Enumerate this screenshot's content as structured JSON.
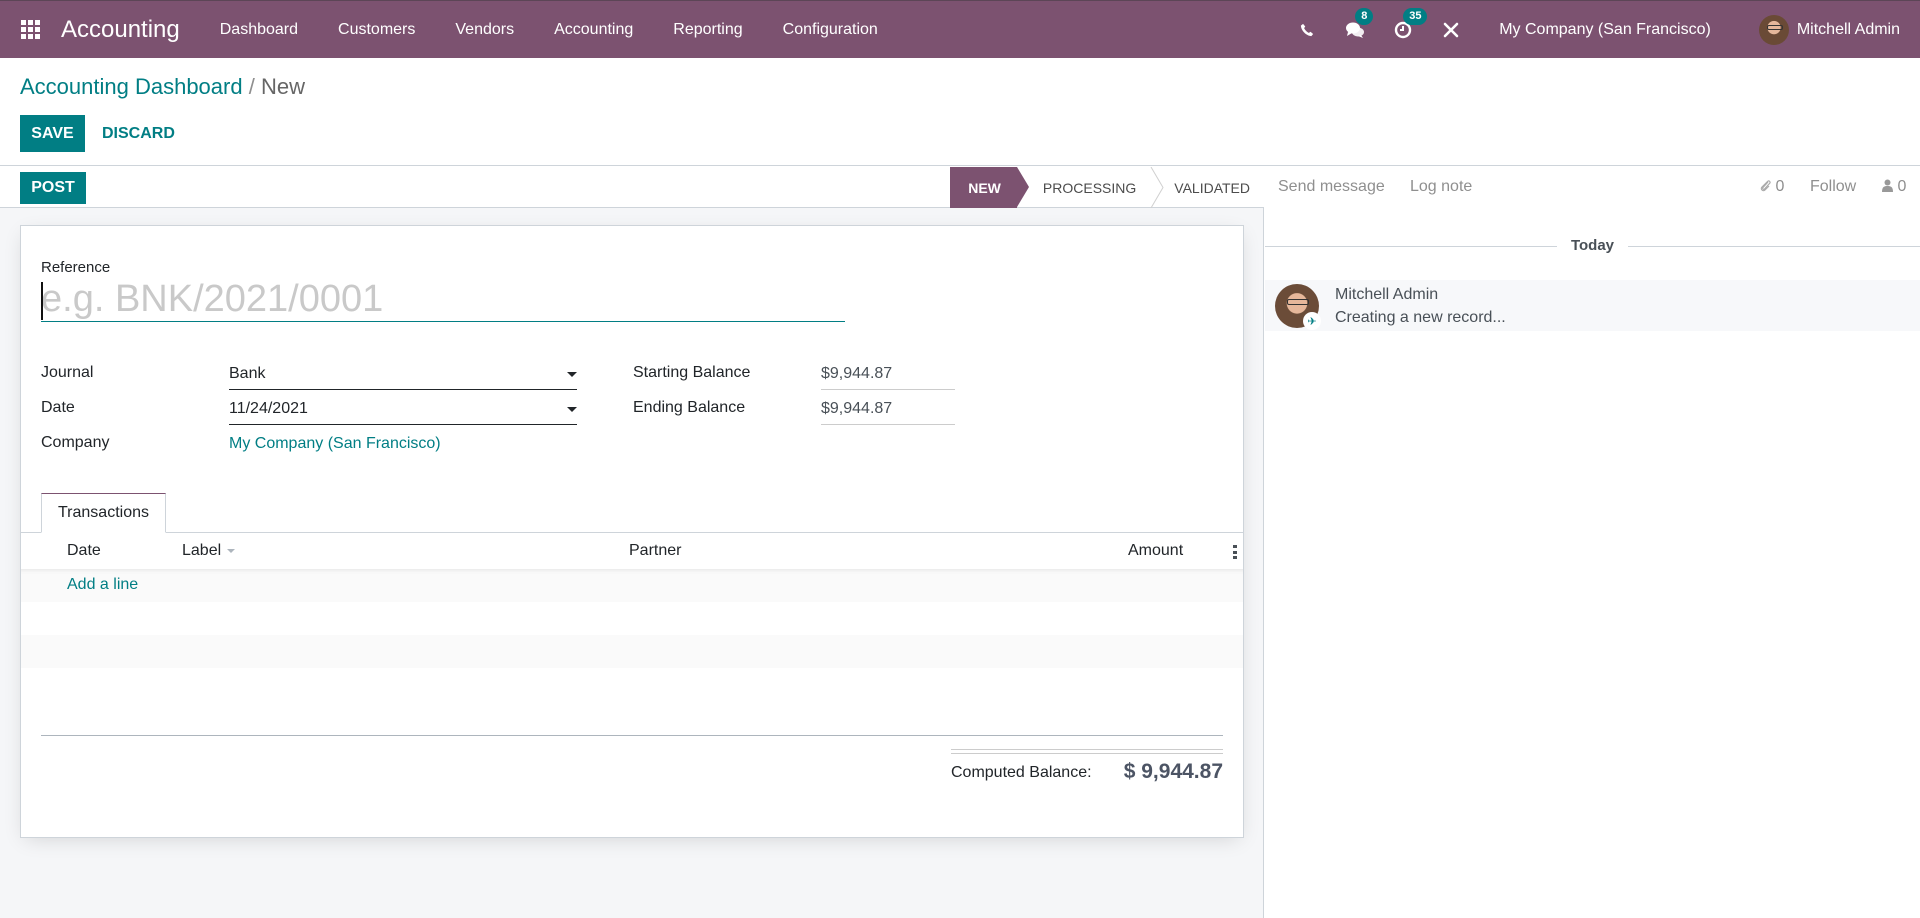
{
  "navbar": {
    "app_name": "Accounting",
    "menu": [
      "Dashboard",
      "Customers",
      "Vendors",
      "Accounting",
      "Reporting",
      "Configuration"
    ],
    "icons": {
      "apps": "apps-grid-icon",
      "phone": "phone-icon",
      "messages": "chat-icon",
      "activities": "clock-icon",
      "debug": "tools-icon"
    },
    "messages_badge": "8",
    "activities_badge": "35",
    "company": "My Company (San Francisco)",
    "user": "Mitchell Admin",
    "bg_color": "#7c5270"
  },
  "control_panel": {
    "breadcrumb_parent": "Accounting Dashboard",
    "breadcrumb_sep": "/",
    "breadcrumb_current": "New",
    "save_label": "SAVE",
    "discard_label": "DISCARD"
  },
  "statusbar": {
    "post_label": "POST",
    "stages": [
      "NEW",
      "PROCESSING",
      "VALIDATED"
    ],
    "active_stage": "NEW"
  },
  "form": {
    "reference_label": "Reference",
    "reference_value": "",
    "reference_placeholder": "e.g. BNK/2021/0001",
    "journal_label": "Journal",
    "journal_value": "Bank",
    "date_label": "Date",
    "date_value": "11/24/2021",
    "company_label": "Company",
    "company_value": "My Company (San Francisco)",
    "starting_balance_label": "Starting Balance",
    "starting_balance_value": "$9,944.87",
    "ending_balance_label": "Ending Balance",
    "ending_balance_value": "$9,944.87"
  },
  "tabs": [
    {
      "label": "Transactions",
      "active": true
    }
  ],
  "transactions": {
    "columns": [
      "Date",
      "Label",
      "Partner",
      "Amount"
    ],
    "add_line_label": "Add a line",
    "rows": [],
    "computed_balance_label": "Computed Balance:",
    "computed_balance_value": "$ 9,944.87"
  },
  "chatter": {
    "send_message_label": "Send message",
    "log_note_label": "Log note",
    "attachments_count": "0",
    "follow_label": "Follow",
    "followers_count": "0",
    "date_separator": "Today",
    "messages": [
      {
        "author": "Mitchell Admin",
        "body": "Creating a new record..."
      }
    ]
  },
  "colors": {
    "primary": "#017e84",
    "brand": "#7c5270"
  }
}
